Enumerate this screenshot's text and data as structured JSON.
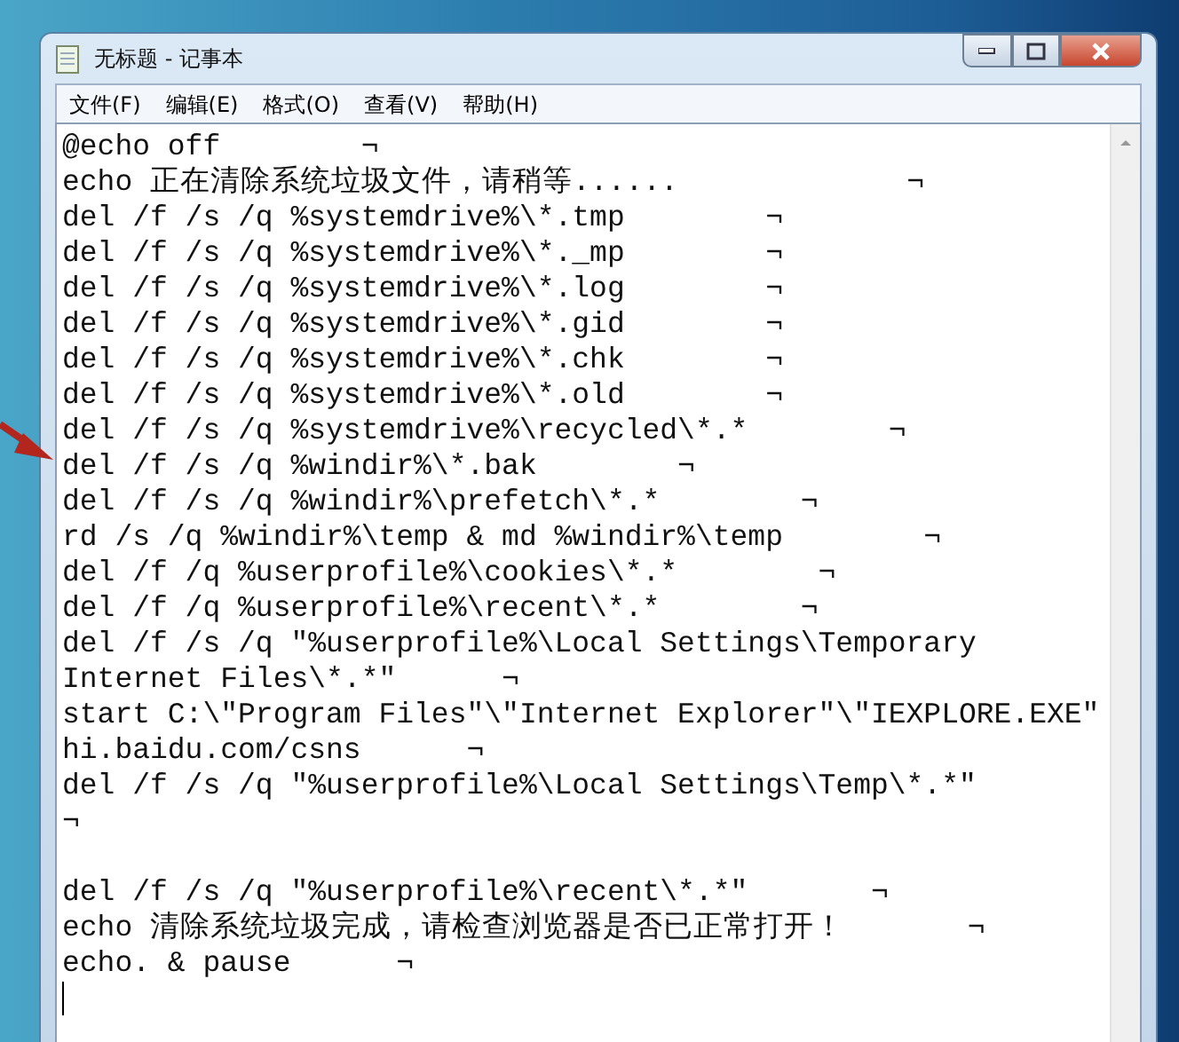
{
  "window": {
    "title": "无标题 - 记事本"
  },
  "menu": [
    "文件(F)",
    "编辑(E)",
    "格式(O)",
    "查看(V)",
    "帮助(H)"
  ],
  "editor": {
    "content": "@echo off        ¬\necho 正在清除系统垃圾文件，请稍等......             ¬\ndel /f /s /q %systemdrive%\\*.tmp        ¬\ndel /f /s /q %systemdrive%\\*._mp        ¬\ndel /f /s /q %systemdrive%\\*.log        ¬\ndel /f /s /q %systemdrive%\\*.gid        ¬\ndel /f /s /q %systemdrive%\\*.chk        ¬\ndel /f /s /q %systemdrive%\\*.old        ¬\ndel /f /s /q %systemdrive%\\recycled\\*.*        ¬\ndel /f /s /q %windir%\\*.bak        ¬\ndel /f /s /q %windir%\\prefetch\\*.*        ¬\nrd /s /q %windir%\\temp & md %windir%\\temp        ¬\ndel /f /q %userprofile%\\cookies\\*.*        ¬\ndel /f /q %userprofile%\\recent\\*.*        ¬\ndel /f /s /q \"%userprofile%\\Local Settings\\Temporary\nInternet Files\\*.*\"      ¬\nstart C:\\\"Program Files\"\\\"Internet Explorer\"\\\"IEXPLORE.EXE\"\nhi.baidu.com/csns      ¬\ndel /f /s /q \"%userprofile%\\Local Settings\\Temp\\*.*\"\n¬\n\ndel /f /s /q \"%userprofile%\\recent\\*.*\"       ¬\necho 清除系统垃圾完成，请检查浏览器是否已正常打开！       ¬\necho. & pause      ¬"
  }
}
